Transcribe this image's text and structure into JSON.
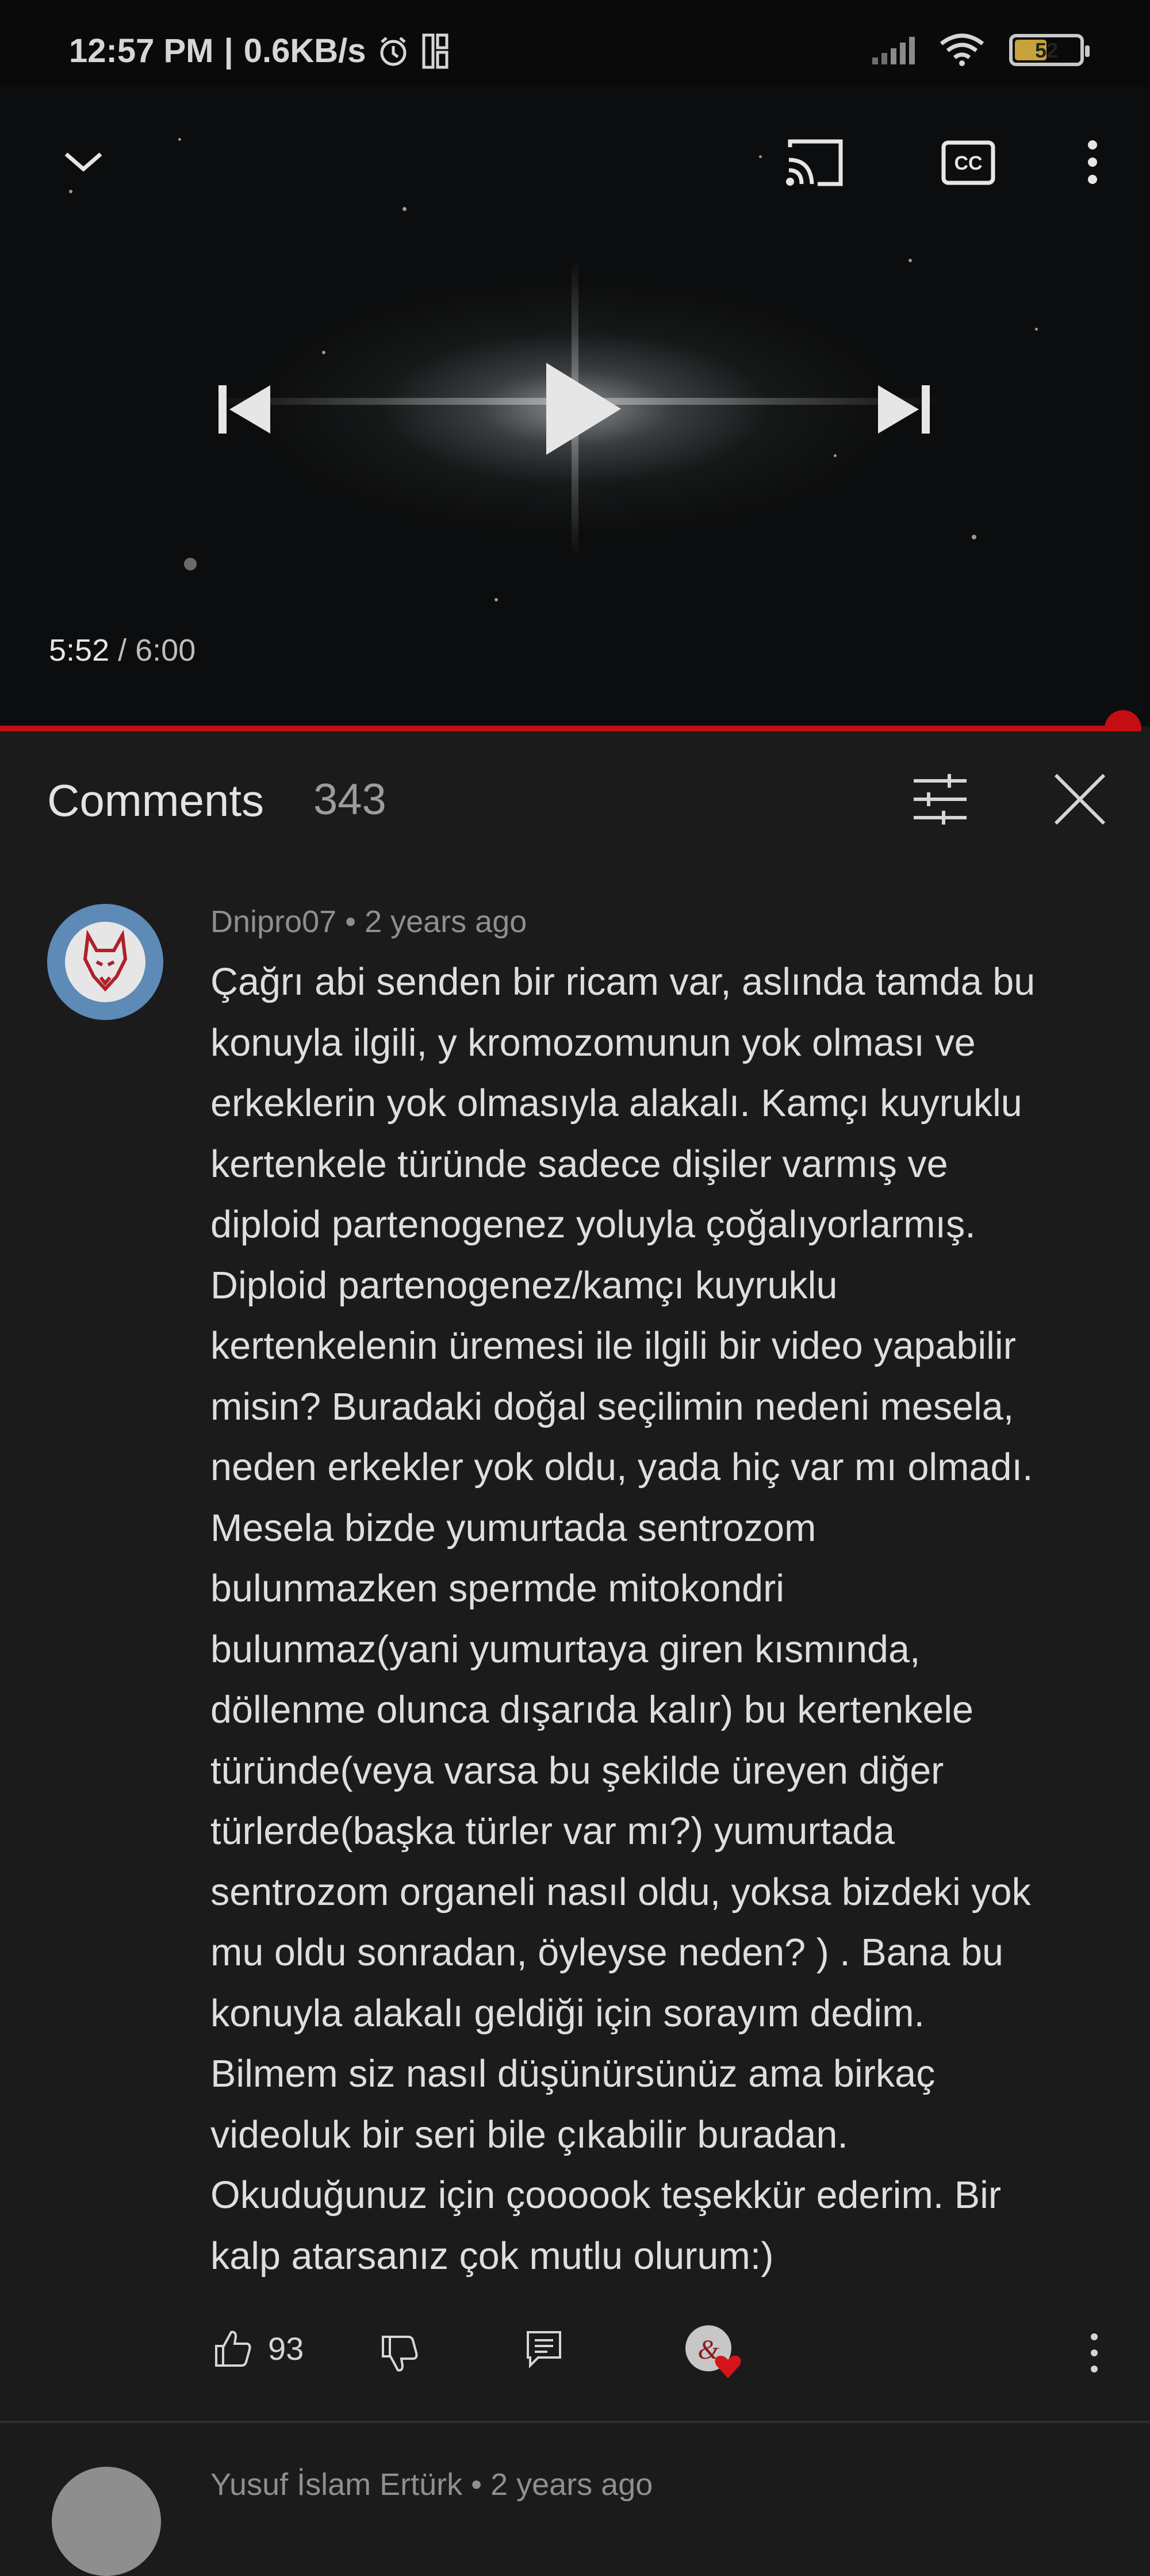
{
  "status_bar": {
    "time": "12:57 PM",
    "speed": "0.6KB/s",
    "battery": "52",
    "battery_level": 0.52,
    "icons": [
      "alarm-icon",
      "sim-card-icon",
      "signal-icon",
      "wifi-icon",
      "battery-icon"
    ]
  },
  "player": {
    "current_time": "5:52",
    "duration": "6:00",
    "progress": 0.9767,
    "controls": [
      "collapse-chevron-icon",
      "cast-icon",
      "captions-icon",
      "more-vert-icon",
      "previous-icon",
      "play-icon",
      "next-icon"
    ],
    "accent_color": "#c40e14"
  },
  "comments": {
    "title": "Comments",
    "count": "343",
    "icons": [
      "sort-filter-icon",
      "close-icon"
    ],
    "items": [
      {
        "author": "Dnipro07",
        "age": "2 years ago",
        "lines": [
          "Çağrı abi senden bir ricam var, aslında tamda bu",
          "konuyla ilgili, y kromozomunun yok olması ve",
          "erkeklerin yok olmasıyla alakalı. Kamçı kuyruklu",
          "kertenkele türünde sadece dişiler varmış ve",
          "diploid partenogenez yoluyla çoğalıyorlarmış.",
          "Diploid partenogenez/kamçı kuyruklu",
          "kertenkelenin üremesi ile ilgili bir video yapabilir",
          "misin? Buradaki doğal seçilimin nedeni mesela,",
          "neden erkekler yok oldu, yada hiç var mı olmadı.",
          "Mesela bizde yumurtada sentrozom",
          "bulunmazken spermde mitokondri",
          "bulunmaz(yani yumurtaya giren kısmında,",
          "döllenme olunca dışarıda kalır) bu kertenkele",
          "türünde(veya varsa bu şekilde üreyen diğer",
          "türlerde(başka türler var mı?) yumurtada",
          "sentrozom organeli nasıl oldu, yoksa bizdeki yok",
          "mu oldu sonradan, öyleyse neden? ) . Bana bu",
          "konuyla alakalı geldiği için sorayım dedim.",
          "Bilmem siz nasıl düşünürsünüz ama birkaç",
          "videoluk bir seri bile çıkabilir buradan.",
          "Okuduğunuz için çoooook teşekkür ederim. Bir",
          "kalp atarsanız çok mutlu olurum:)"
        ],
        "likes": "93",
        "action_icons": [
          "thumbs-up-icon",
          "thumbs-down-icon",
          "reply-icon",
          "creator-heart-icon",
          "more-vert-icon"
        ]
      },
      {
        "author": "Yusuf İslam Ertürk",
        "age": "2 years ago"
      }
    ]
  }
}
